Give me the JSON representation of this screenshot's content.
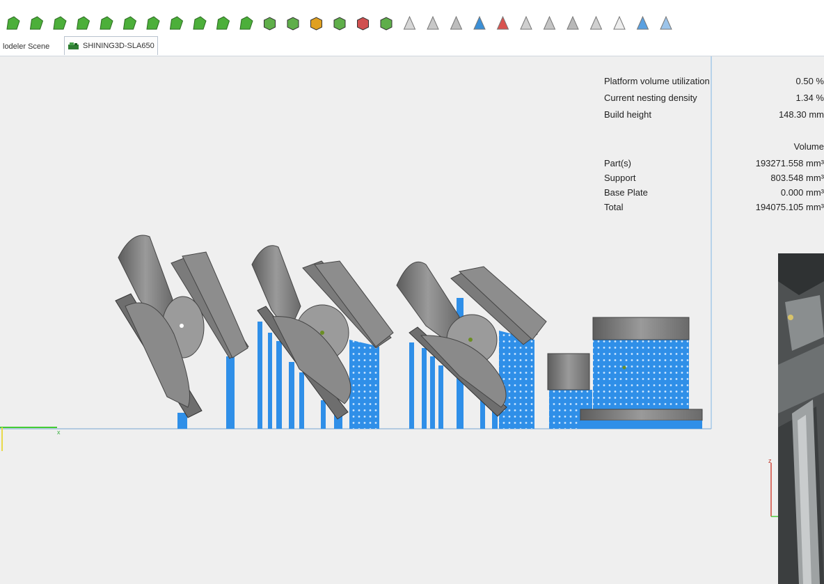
{
  "toolbar": {
    "icons": [
      "part-green-icon",
      "curve-green-icon",
      "globe-green-icon",
      "square-green-icon",
      "tree-green-icon",
      "cut-green-icon",
      "mesh-green-icon",
      "multi-green-icon",
      "flower-green-icon",
      "gear-green-icon",
      "fan-green-icon",
      "cube-select-icon",
      "cube-fill-icon",
      "cube-color-icon",
      "cube-wire-icon",
      "cube-red-icon",
      "cube-green-icon",
      "support-cone-icon",
      "support-line-icon",
      "support-multi-icon",
      "support-blue-icon",
      "support-red-icon",
      "support-grey-icon",
      "support-double-icon",
      "support-flat-icon",
      "support-outline-icon",
      "support-edit-icon",
      "support-light-icon",
      "support-cut-icon"
    ]
  },
  "tabs": [
    {
      "label": "lodeler Scene",
      "active": false
    },
    {
      "label": "SHINING3D-SLA650",
      "active": true
    }
  ],
  "stats": {
    "platform_volume_label": "Platform volume utilization",
    "platform_volume_value": "0.50 %",
    "nesting_density_label": "Current nesting density",
    "nesting_density_value": "1.34 %",
    "build_height_label": "Build height",
    "build_height_value": "148.30 mm",
    "volume_header": "Volume",
    "parts_label": "Part(s)",
    "parts_value": "193271.558 mm³",
    "support_label": "Support",
    "support_value": "803.548 mm³",
    "base_plate_label": "Base Plate",
    "base_plate_value": "0.000 mm³",
    "total_label": "Total",
    "total_value": "194075.105 mm³"
  },
  "axes": {
    "x_label": "x",
    "z_label": "z"
  },
  "colors": {
    "support_blue": "#2f8fe8",
    "part_grey": "#8a8a8a",
    "toolbar_green": "#4caf3a",
    "axis_green": "#44cc33",
    "axis_red": "#d0392b"
  }
}
